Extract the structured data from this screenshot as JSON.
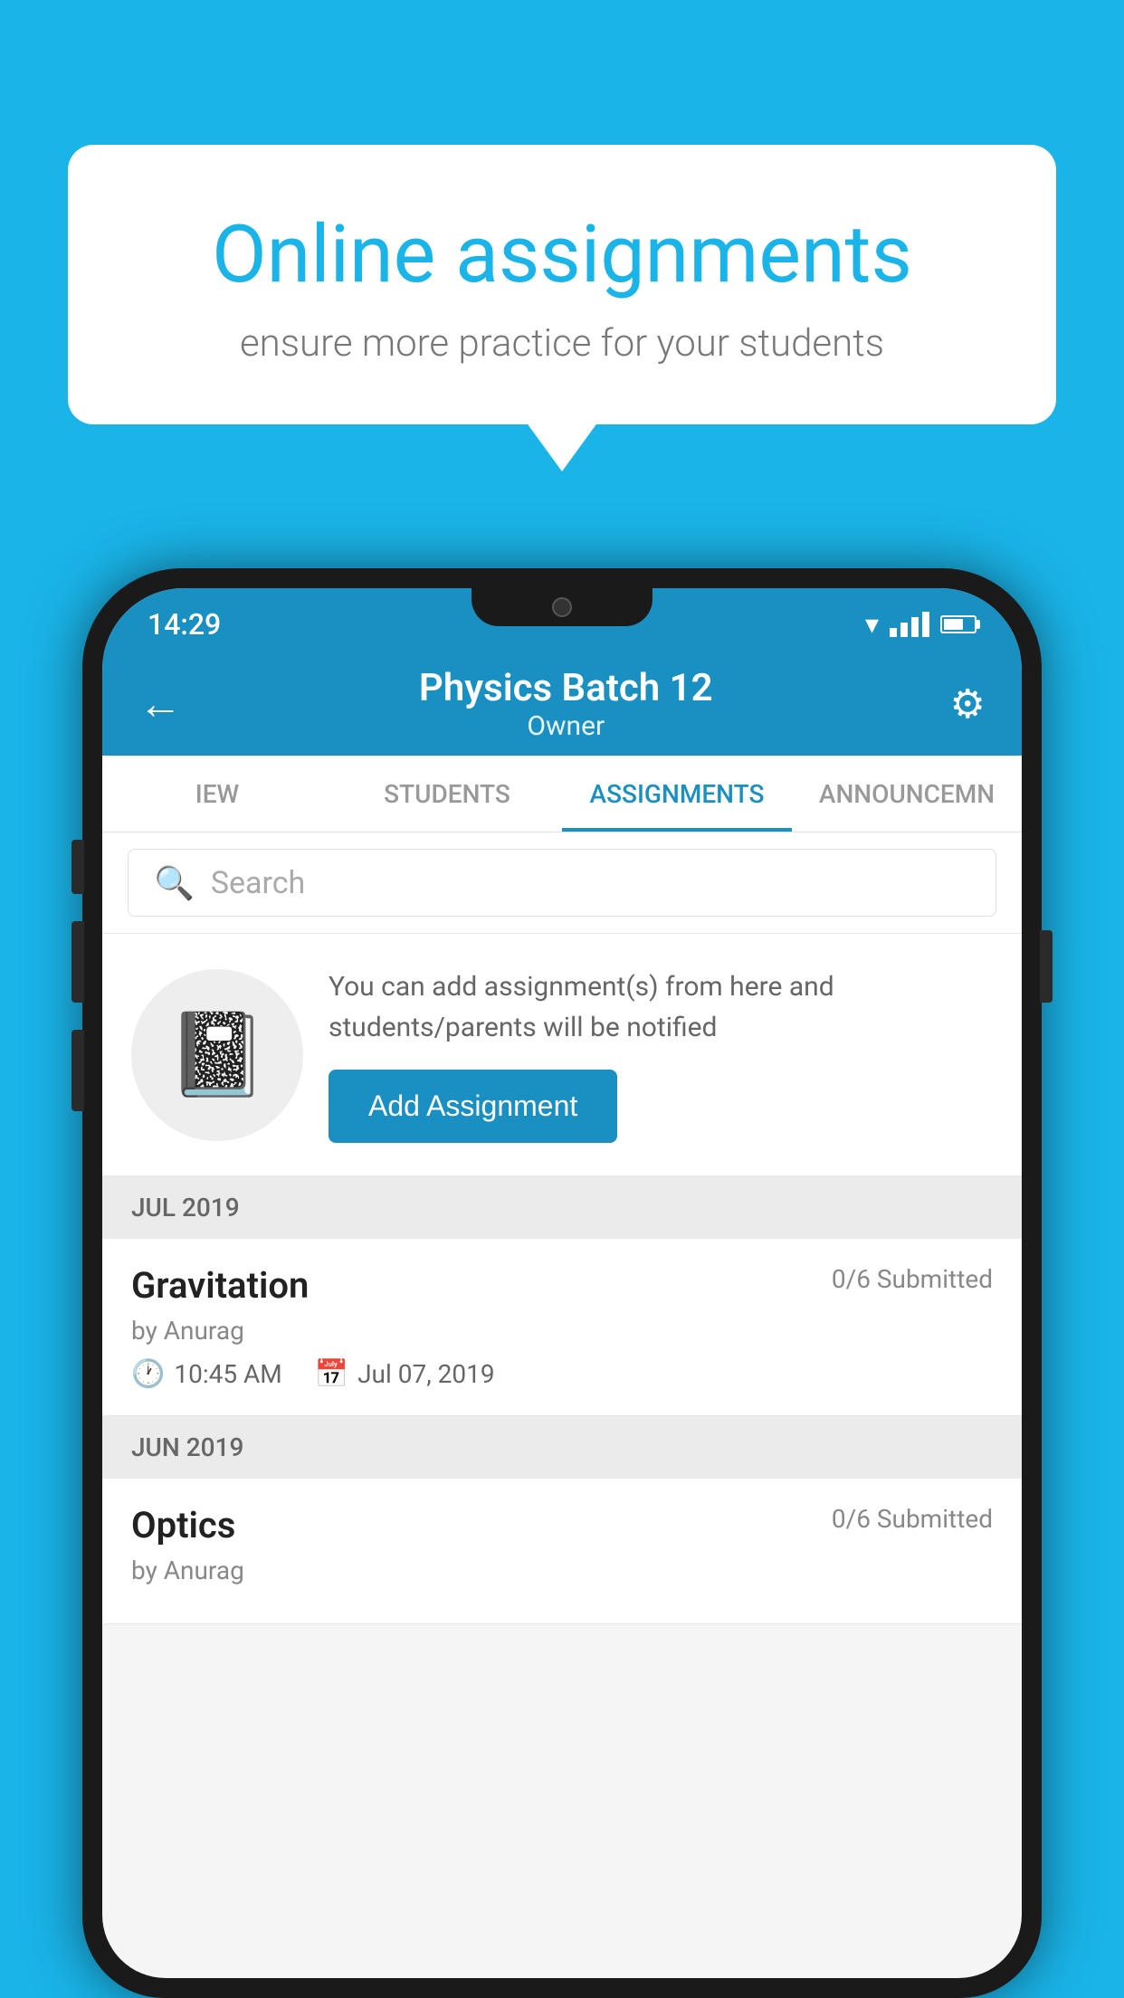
{
  "background_color": "#1ab4e8",
  "speech_bubble": {
    "title": "Online assignments",
    "subtitle": "ensure more practice for your students"
  },
  "status_bar": {
    "time": "14:29"
  },
  "header": {
    "title": "Physics Batch 12",
    "subtitle": "Owner",
    "back_label": "←",
    "settings_label": "⚙"
  },
  "tabs": [
    {
      "label": "IEW",
      "active": false
    },
    {
      "label": "STUDENTS",
      "active": false
    },
    {
      "label": "ASSIGNMENTS",
      "active": true
    },
    {
      "label": "ANNOUNCEMENTS",
      "active": false
    }
  ],
  "search": {
    "placeholder": "Search"
  },
  "promo": {
    "text": "You can add assignment(s) from here and students/parents will be notified",
    "button_label": "Add Assignment"
  },
  "sections": [
    {
      "label": "JUL 2019",
      "assignments": [
        {
          "name": "Gravitation",
          "status": "0/6 Submitted",
          "author": "by Anurag",
          "time": "10:45 AM",
          "date": "Jul 07, 2019"
        }
      ]
    },
    {
      "label": "JUN 2019",
      "assignments": [
        {
          "name": "Optics",
          "status": "0/6 Submitted",
          "author": "by Anurag",
          "time": "",
          "date": ""
        }
      ]
    }
  ]
}
